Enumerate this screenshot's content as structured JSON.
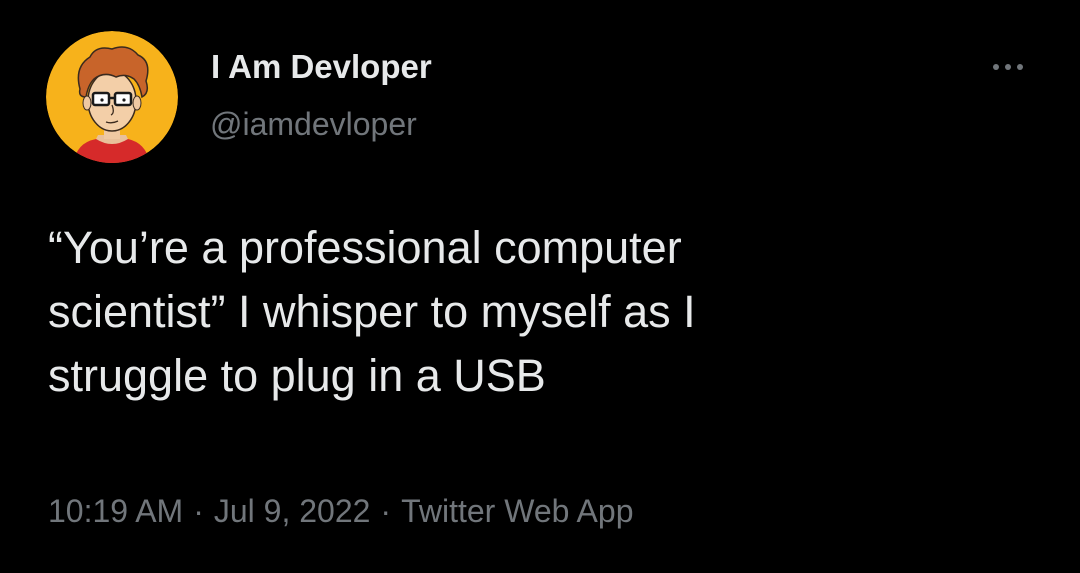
{
  "author": {
    "display_name": "I Am Devloper",
    "handle": "@iamdevloper",
    "avatar_icon": "cartoon-developer-avatar-icon"
  },
  "more_icon": "more-horizontal-icon",
  "tweet": {
    "lines": [
      "“You’re a professional computer",
      "scientist” I whisper to myself as I",
      "struggle to plug in a USB"
    ]
  },
  "meta": {
    "time": "10:19 AM",
    "date": "Jul 9, 2022",
    "source": "Twitter Web App",
    "separator": "·"
  },
  "colors": {
    "background": "#000000",
    "primary_text": "#e7e9ea",
    "secondary_text": "#71767b",
    "avatar_bg": "#f7b21b"
  }
}
